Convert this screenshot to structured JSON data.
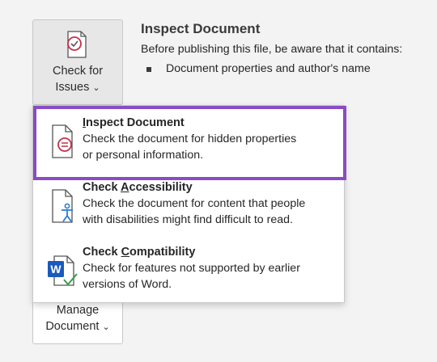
{
  "check_for_issues": {
    "line1": "Check for",
    "line2": "Issues",
    "chevron": "⌄"
  },
  "manage_document": {
    "line1": "Manage",
    "line2": "Document",
    "chevron": "⌄"
  },
  "inspect_panel": {
    "title": "Inspect Document",
    "description": "Before publishing this file, be aware that it contains:",
    "bullet": "Document properties and author's name"
  },
  "menu": {
    "items": [
      {
        "pre": "",
        "accel": "I",
        "post": "nspect Document",
        "description": [
          "Check the document for hidden properties",
          "or personal information."
        ],
        "icon": "document-inspect-icon"
      },
      {
        "pre": "Check ",
        "accel": "A",
        "post": "ccessibility",
        "description": [
          "Check the document for content that people",
          "with disabilities might find difficult to read."
        ],
        "icon": "accessibility-icon"
      },
      {
        "pre": "Check ",
        "accel": "C",
        "post": "ompatibility",
        "description": [
          "Check for features not supported by earlier",
          "versions of Word."
        ],
        "icon": "word-compatibility-icon"
      }
    ]
  },
  "colors": {
    "highlight": "#8a4bc3",
    "icon_red": "#c4314b",
    "icon_blue": "#2b7cd3",
    "word_blue": "#185abd",
    "check_green": "#3a9b4a"
  }
}
